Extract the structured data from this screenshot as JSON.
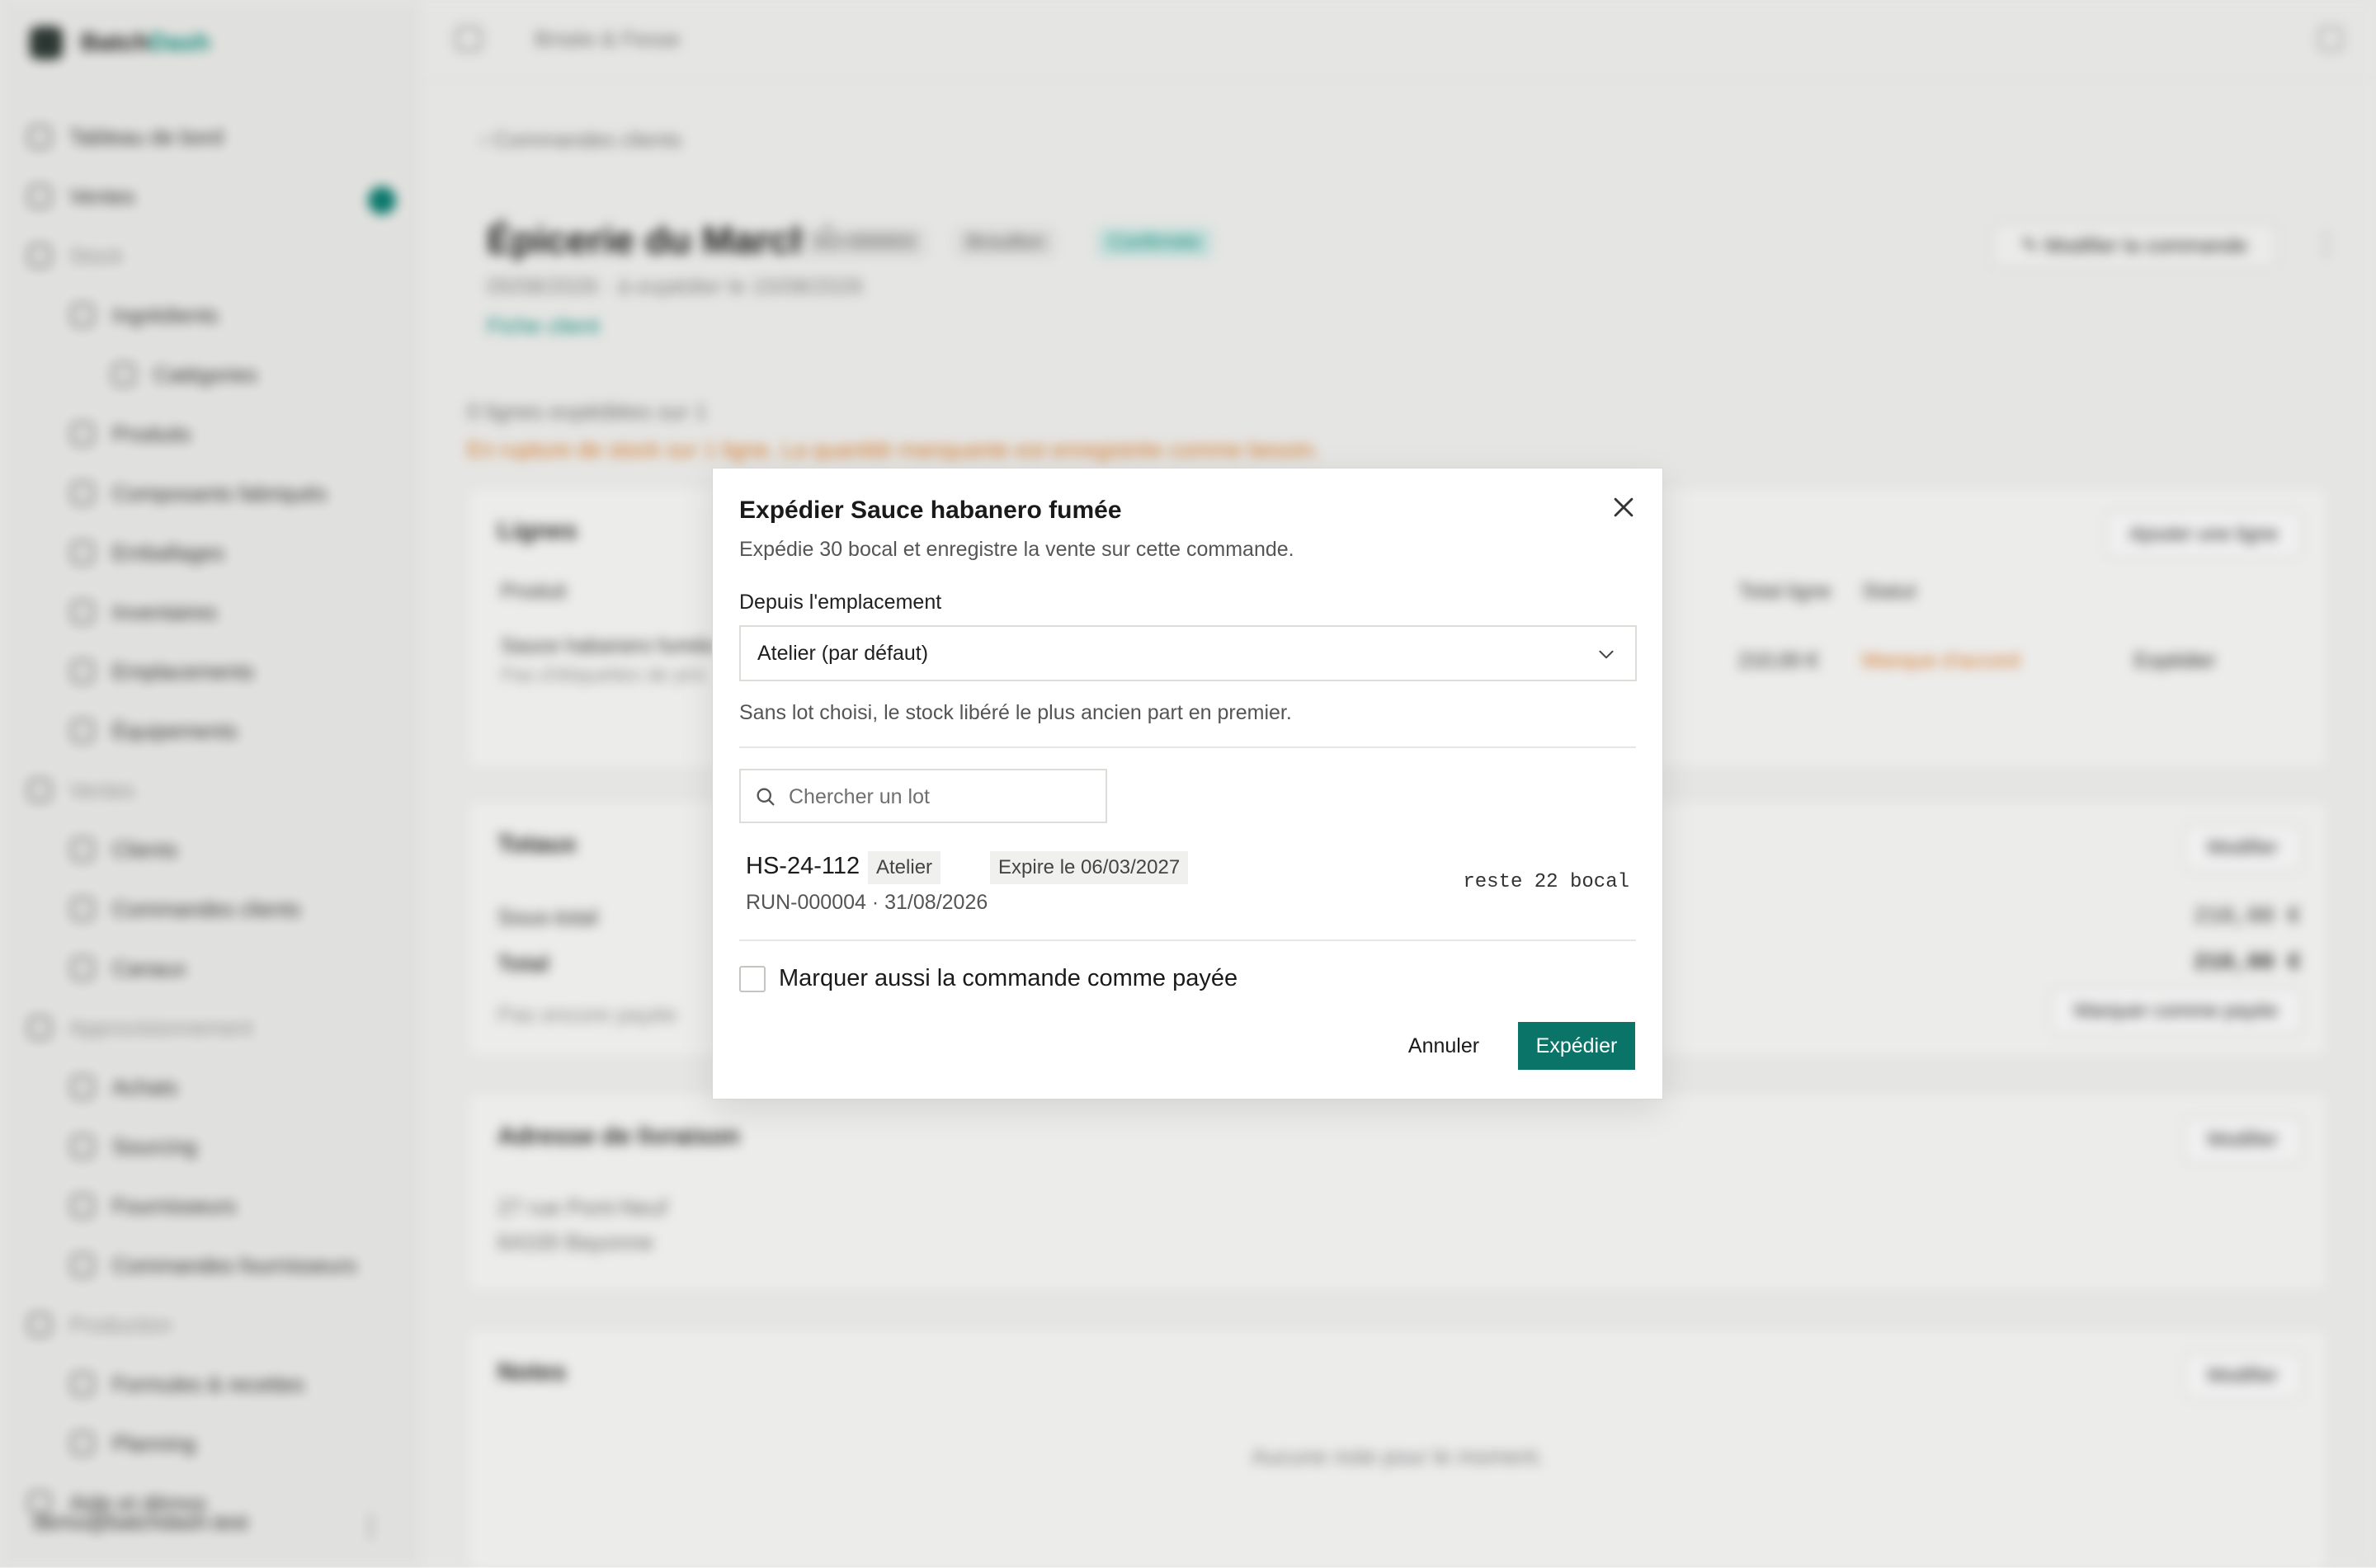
{
  "app": {
    "brand_main": "Batch",
    "brand_accent": "Dash",
    "top_title": "Brisée & Fesse",
    "accent_color": "#0b7468",
    "warning_color": "#e07b24"
  },
  "sidebar": {
    "items": [
      {
        "label": "Tableau de bord"
      },
      {
        "label": "Ventes"
      },
      {
        "label": "Stock"
      },
      {
        "label": "Ingrédients"
      },
      {
        "label": "Catégories"
      },
      {
        "label": "Produits"
      },
      {
        "label": "Composants fabriqués"
      },
      {
        "label": "Emballages"
      },
      {
        "label": "Inventaires"
      },
      {
        "label": "Emplacements"
      },
      {
        "label": "Équipements"
      },
      {
        "label": "Ventes"
      },
      {
        "label": "Clients"
      },
      {
        "label": "Commandes clients"
      },
      {
        "label": "Canaux"
      },
      {
        "label": "Approvisionnement"
      },
      {
        "label": "Achats"
      },
      {
        "label": "Sourcing"
      },
      {
        "label": "Fournisseurs"
      },
      {
        "label": "Commandes fournisseurs"
      },
      {
        "label": "Production"
      },
      {
        "label": "Formules & recettes"
      },
      {
        "label": "Planning"
      },
      {
        "label": "Aide et démos"
      }
    ],
    "user_email": "demo@batchdash.test"
  },
  "page": {
    "back_label": "Commandes clients",
    "customer_name": "Épicerie du Marché",
    "order_no": "SO-000003",
    "badge_draft": "Brouillon",
    "badge_status": "Confirmée",
    "meta": "05/08/2026 · à expédier le 15/08/2026",
    "customer_link": "Fiche client",
    "edit_order_label": "Modifier la commande",
    "shipped_summary": "0 lignes expédiées sur 1",
    "warning_text": "En rupture de stock sur 1 ligne. La quantité manquante est enregistrée comme besoin.",
    "lines_card": {
      "title": "Lignes",
      "add_label": "Ajouter une ligne",
      "col_product": "Produit",
      "col_total": "Total ligne",
      "col_status": "Statut",
      "row_product": "Sauce habanero fumée",
      "row_sub": "Pas d'étiquettes de prix",
      "row_total": "210,00 €",
      "row_status": "Manque d'accord",
      "row_action": "Expédier"
    },
    "totals_card": {
      "title": "Totaux",
      "edit_label": "Modifier",
      "subtotal_label": "Sous-total",
      "subtotal_value": "210,00 €",
      "total_label": "Total",
      "total_value": "210,00 €",
      "paid_note": "Pas encore payée",
      "mark_paid_label": "Marquer comme payée"
    },
    "address_card": {
      "title": "Adresse de livraison",
      "edit_label": "Modifier",
      "line1": "27 rue Pont-Neuf",
      "line2": "64100 Bayonne"
    },
    "notes_card": {
      "title": "Notes",
      "edit_label": "Modifier",
      "empty": "Aucune note pour le moment."
    }
  },
  "modal": {
    "title": "Expédier Sauce habanero fumée",
    "description": "Expédie 30 bocal et enregistre la vente sur cette commande.",
    "location_label": "Depuis l'emplacement",
    "location_value": "Atelier (par défaut)",
    "hint": "Sans lot choisi, le stock libéré le plus ancien part en premier.",
    "search_placeholder": "Chercher un lot",
    "lots": [
      {
        "id": "HS-24-112",
        "location": "Atelier",
        "expiry": "Expire le 06/03/2027",
        "run": "RUN-000004 · 31/08/2026",
        "remaining": "reste 22 bocal"
      }
    ],
    "mark_paid_label": "Marquer aussi la commande comme payée",
    "mark_paid_checked": false,
    "cancel_label": "Annuler",
    "ship_label": "Expédier"
  }
}
